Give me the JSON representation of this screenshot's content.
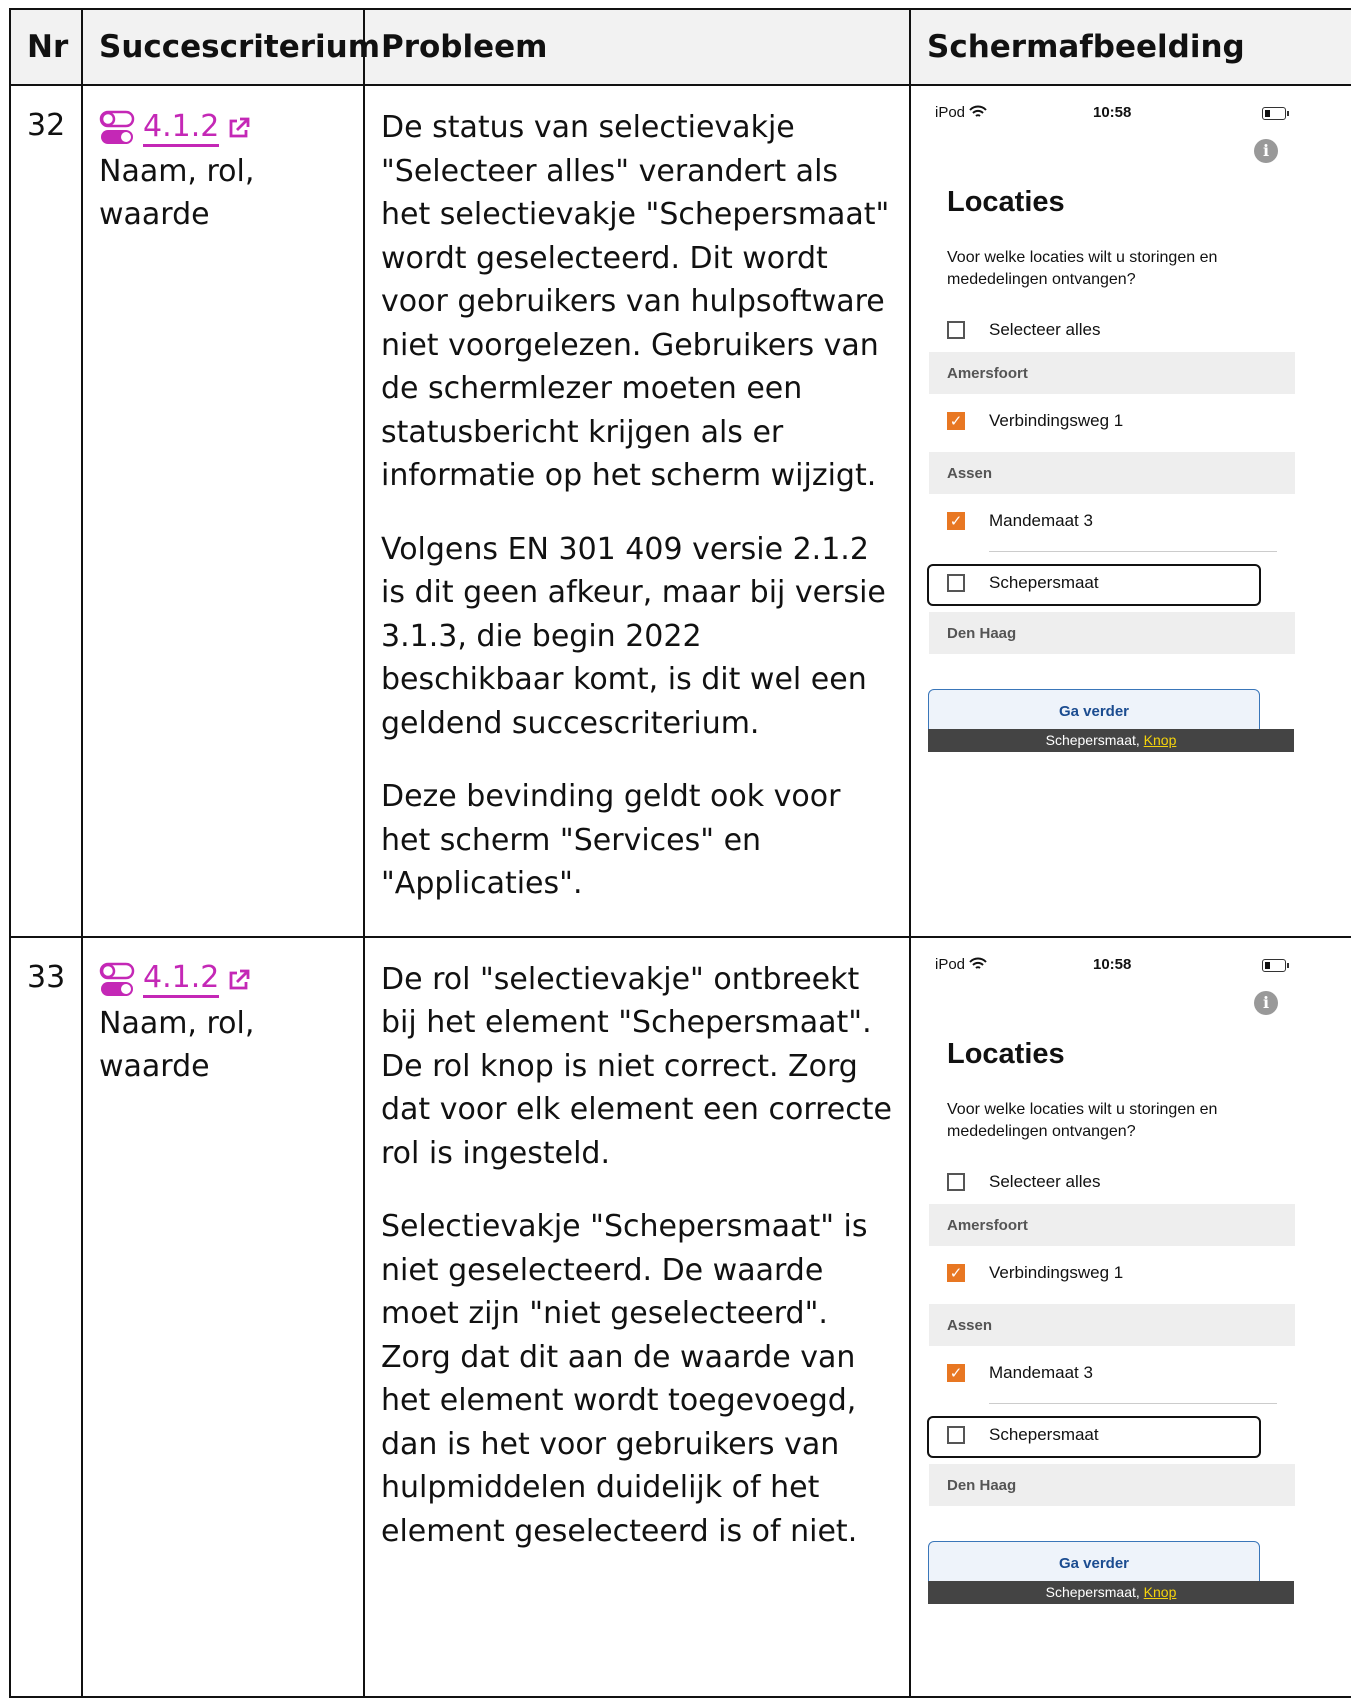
{
  "headers": {
    "nr": "Nr",
    "criterion": "Succescriterium",
    "problem": "Probleem",
    "screenshot": "Schermafbeelding"
  },
  "rows": [
    {
      "nr": "32",
      "criterion_code": "4.1.2",
      "criterion_name": "Naam, rol, waarde",
      "problem": [
        "De status van selectievakje \"Selecteer alles\" verandert als het selectievakje \"Schepersmaat\" wordt geselecteerd. Dit wordt voor gebruikers van hulpsoftware niet voorgelezen. Gebruikers van de schermlezer moeten een statusbericht krijgen als er informatie op het scherm wijzigt.",
        "Volgens EN 301 409 versie 2.1.2 is dit geen afkeur, maar bij versie 3.1.3, die begin 2022 beschikbaar komt, is dit wel een geldend succescriterium.",
        "Deze bevinding geldt ook voor het scherm \"Services\" en \"Applicaties\"."
      ]
    },
    {
      "nr": "33",
      "criterion_code": "4.1.2",
      "criterion_name": "Naam, rol, waarde",
      "problem": [
        "De rol \"selectievakje\" ontbreekt bij het element \"Schepersmaat\". De rol knop is niet correct. Zorg dat voor elk element een correcte rol is ingesteld.",
        "Selectievakje \"Schepersmaat\" is niet geselecteerd. De waarde moet zijn \"niet geselecteerd\". Zorg dat dit aan de waarde van het element wordt toegevoegd, dan is het voor gebruikers van hulpmiddelen duidelijk of het element geselecteerd is of niet."
      ]
    }
  ],
  "phone": {
    "carrier": "iPod",
    "time": "10:58",
    "info_icon": "i",
    "title": "Locaties",
    "question": "Voor welke locaties wilt u storingen en mededelingen ontvangen?",
    "select_all": "Selecteer alles",
    "sections": [
      {
        "name": "Amersfoort",
        "items": [
          {
            "label": "Verbindingsweg 1",
            "checked": true
          }
        ]
      },
      {
        "name": "Assen",
        "items": [
          {
            "label": "Mandemaat 3",
            "checked": true
          },
          {
            "label": "Schepersmaat",
            "checked": false
          }
        ]
      },
      {
        "name": "Den Haag",
        "items": []
      }
    ],
    "button": "Ga verder",
    "caption_prefix": "Schepersmaat, ",
    "caption_role": "Knop"
  },
  "colors": {
    "link": "#c428b6",
    "checkbox_on": "#e87722",
    "caption_bg": "#444444",
    "caption_role": "#f5d40c"
  }
}
